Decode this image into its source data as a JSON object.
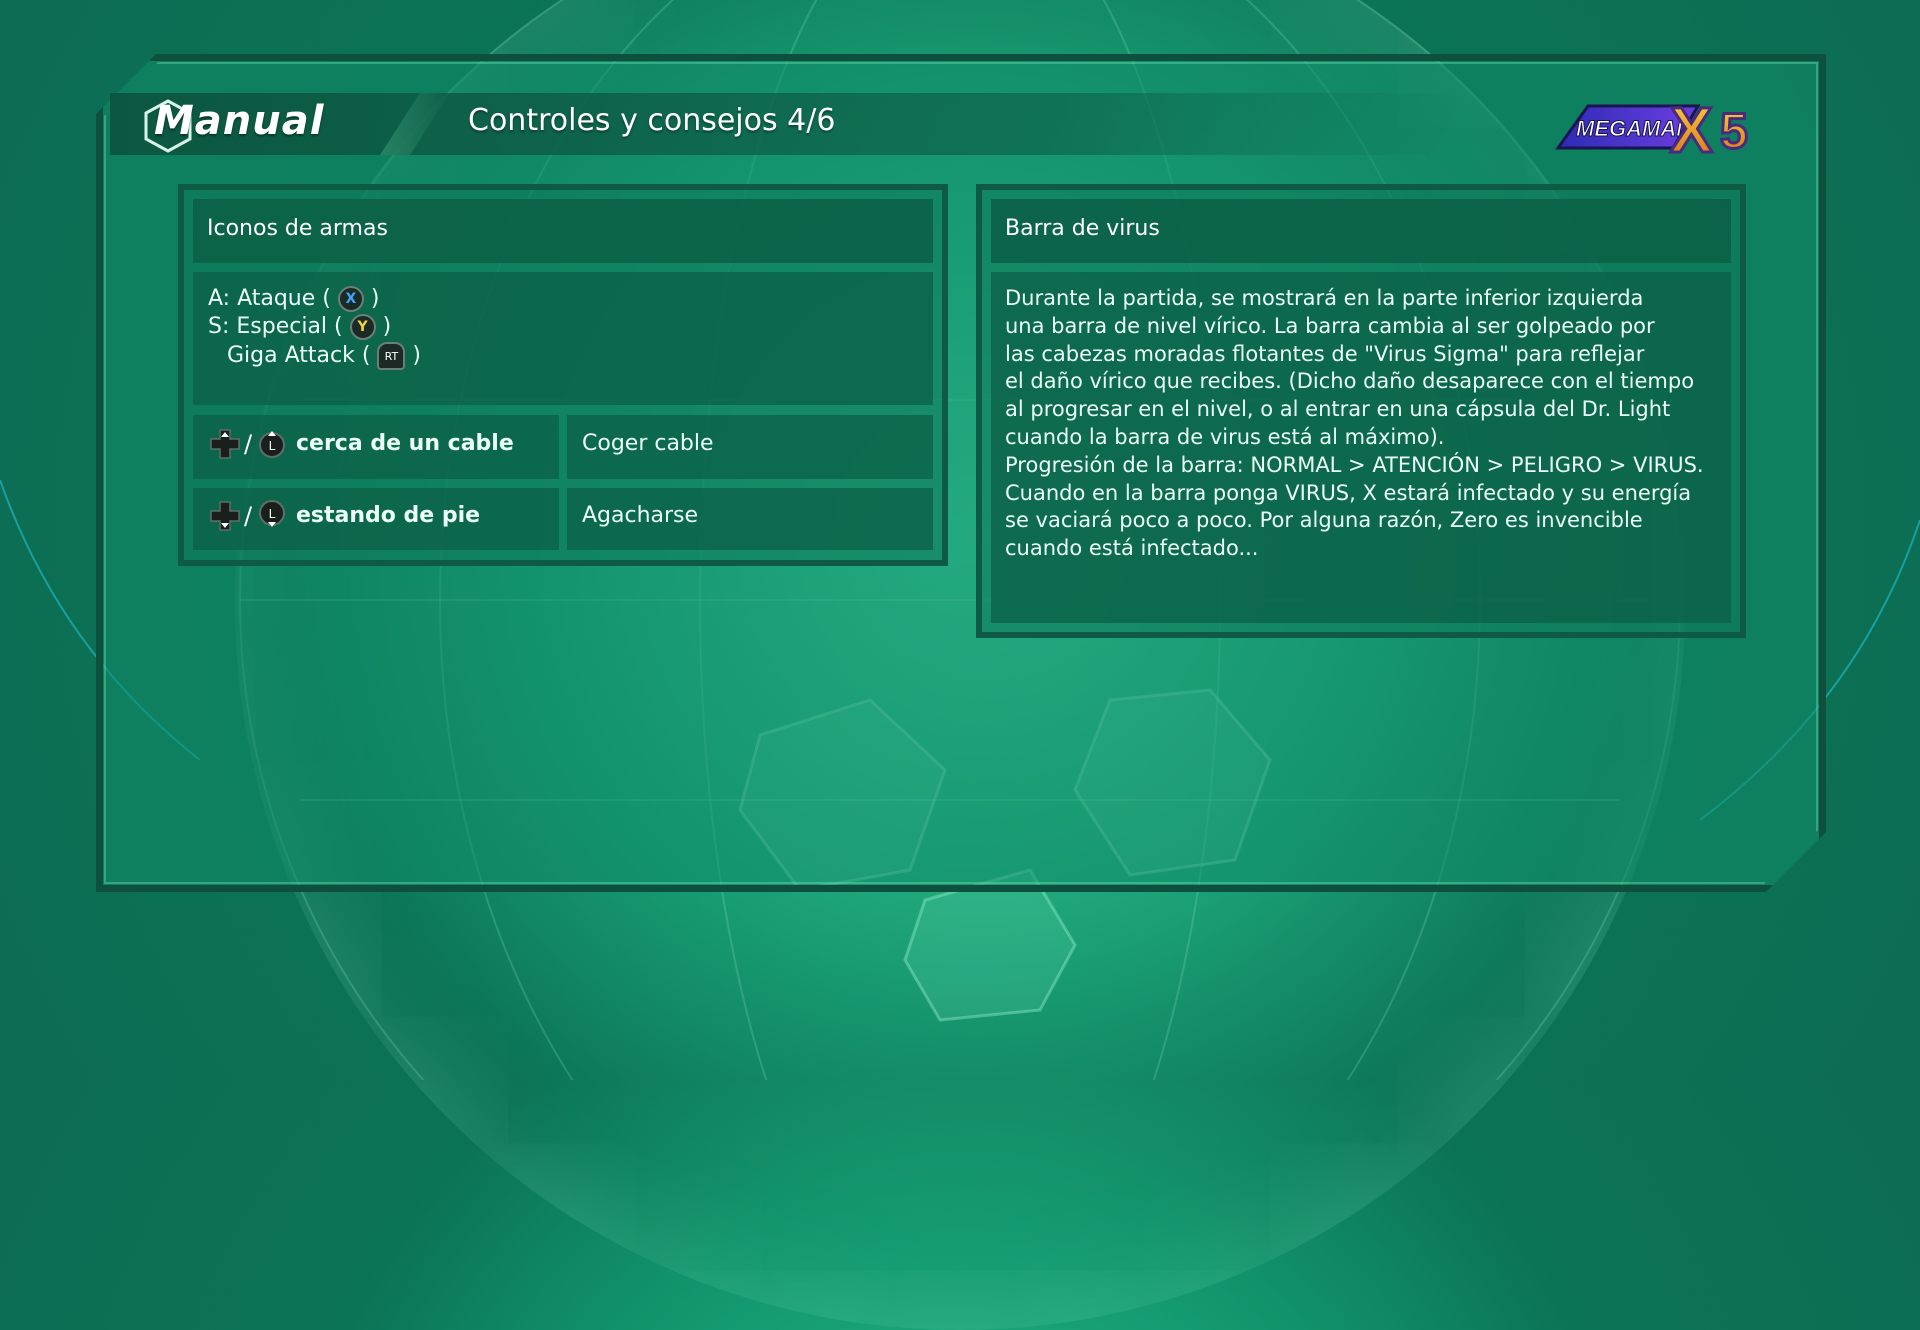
{
  "header": {
    "manual_label": "Manual",
    "page_title": "Controles y consejos 4/6",
    "logo_text": "MEGAMAN X5"
  },
  "weapons_panel": {
    "title": "Iconos de armas",
    "lines": [
      {
        "prefix": "A: Ataque (",
        "button": "X",
        "suffix": ")"
      },
      {
        "prefix": "S: Especial (",
        "button": "Y",
        "suffix": ")"
      },
      {
        "prefix": "Giga Attack (",
        "button": "RT",
        "suffix": ")"
      }
    ],
    "rows": [
      {
        "condition": "cerca de un cable",
        "action": "Coger cable"
      },
      {
        "condition": "estando de pie",
        "action": "Agacharse"
      }
    ]
  },
  "virus_panel": {
    "title": "Barra de virus",
    "body": "Durante la partida, se mostrará en la parte inferior izquierda\nuna barra de nivel vírico. La barra cambia al ser golpeado por\nlas cabezas moradas flotantes de \"Virus Sigma\" para reflejar\nel daño vírico que recibes. (Dicho daño desaparece con el tiempo\nal progresar en el nivel, o al entrar en una cápsula del Dr. Light\ncuando la barra de virus está al máximo).\nProgresión de la barra: NORMAL > ATENCIÓN > PELIGRO > VIRUS.\nCuando en la barra ponga VIRUS, X estará infectado y su energía\nse vaciará poco a poco. Por alguna razón, Zero es invencible\ncuando está infectado..."
  },
  "colors": {
    "background": "#12966c",
    "panel_border": "#0e5a45",
    "panel_fill": "#0b5c44",
    "button_x": "#3da7ff",
    "button_y": "#f4d23a"
  },
  "icons": [
    "dpad-icon",
    "left-stick-up-icon",
    "left-stick-down-icon",
    "x-button-icon",
    "y-button-icon",
    "rt-trigger-icon",
    "hexagon-icon"
  ]
}
